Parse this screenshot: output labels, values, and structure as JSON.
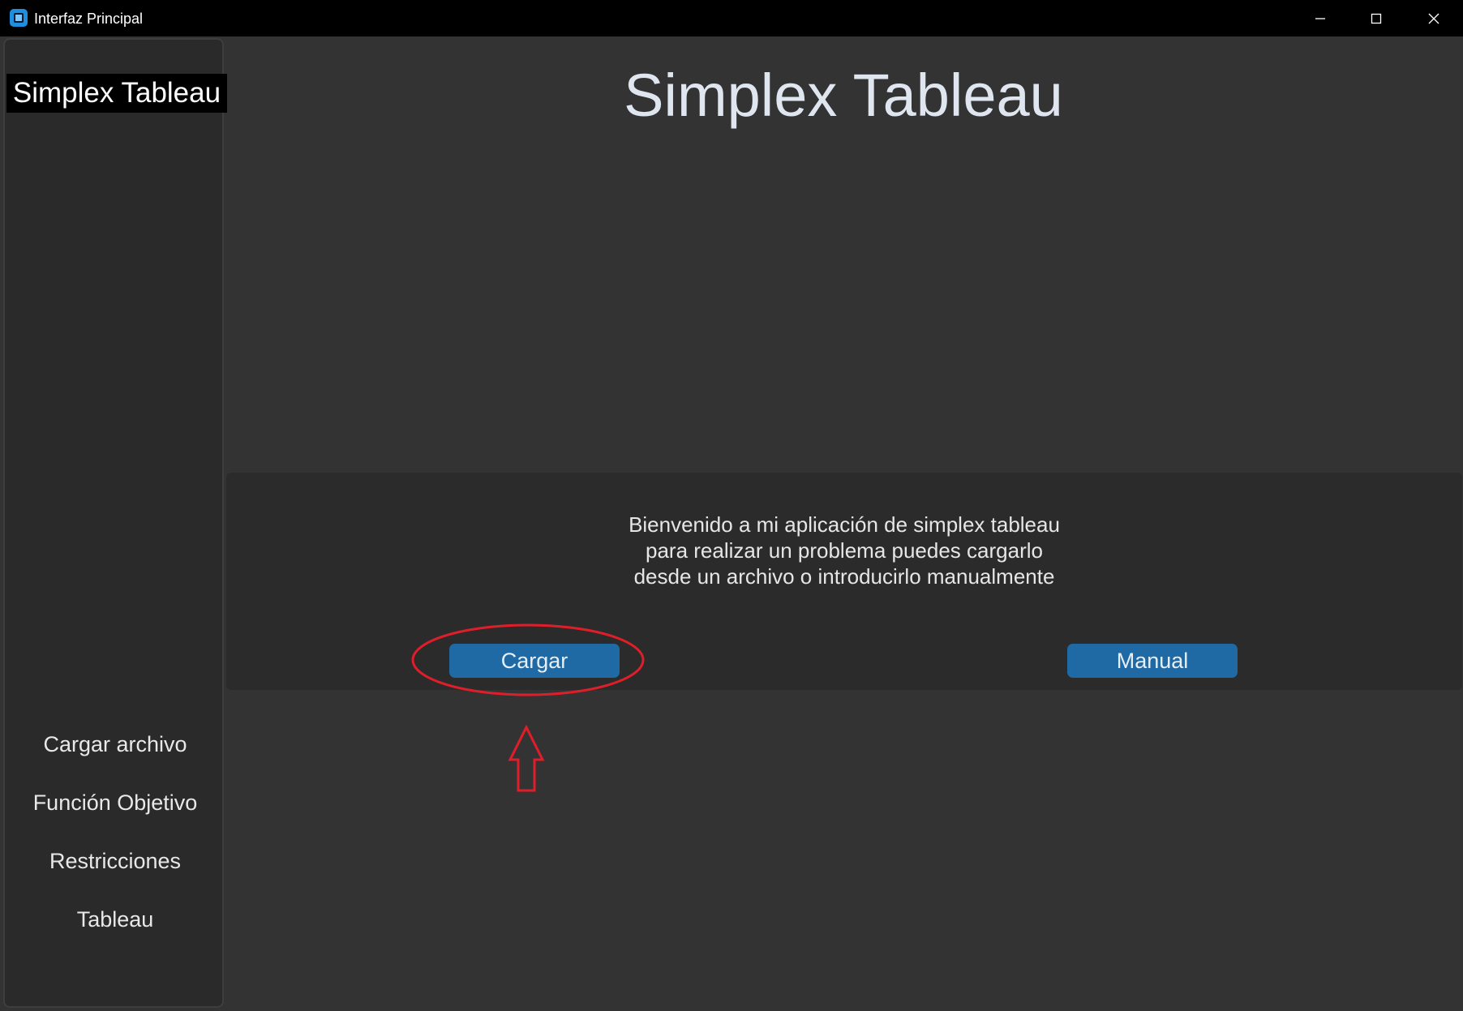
{
  "window": {
    "title": "Interfaz Principal"
  },
  "sidebar": {
    "title": "Simplex Tableau",
    "items": [
      {
        "label": "Cargar archivo"
      },
      {
        "label": "Función Objetivo"
      },
      {
        "label": "Restricciones"
      },
      {
        "label": "Tableau"
      }
    ]
  },
  "main": {
    "title": "Simplex Tableau",
    "welcome_lines": [
      "Bienvenido a mi aplicación de simplex tableau",
      "para realizar un problema puedes cargarlo",
      "desde un archivo o introducirlo manualmente"
    ],
    "buttons": {
      "load_label": "Cargar",
      "manual_label": "Manual"
    }
  },
  "icons": {
    "app": "app-icon",
    "minimize": "minimize-icon",
    "maximize": "maximize-icon",
    "close": "close-icon",
    "annotation_arrow": "arrow-up-icon"
  },
  "colors": {
    "accent_button": "#1f6aa5",
    "annotation": "#e01e2a",
    "background": "#333333",
    "sidebar": "#2a2a2a"
  }
}
